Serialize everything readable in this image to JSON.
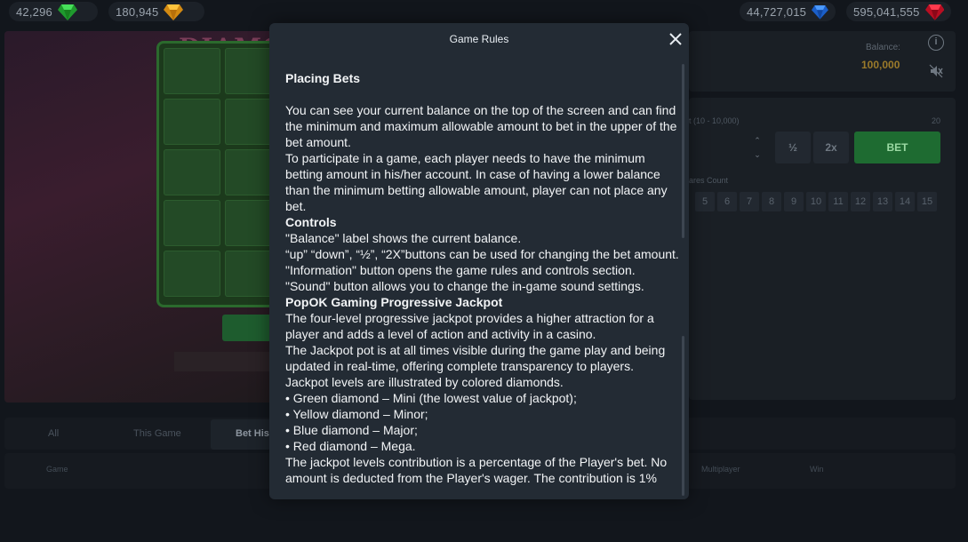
{
  "jackpots": [
    {
      "name": "green",
      "value": "42,296",
      "color": "#2ecc40"
    },
    {
      "name": "yellow",
      "value": "180,945",
      "color": "#f0a21a"
    },
    {
      "name": "blue",
      "value": "44,727,015",
      "color": "#1e6fe0"
    },
    {
      "name": "red",
      "value": "595,041,555",
      "color": "#d6102a"
    }
  ],
  "game": {
    "title": "DIAMO"
  },
  "account": {
    "balance_label": "Balance:",
    "balance_value": "100,000"
  },
  "bet": {
    "range_label": "t (10 - 10,000)",
    "max_label": "20",
    "half_label": "½",
    "double_label": "2x",
    "bet_label": "BET",
    "squares_label": "ares Count",
    "squares": [
      "5",
      "6",
      "7",
      "8",
      "9",
      "10",
      "11",
      "12",
      "13",
      "14",
      "15"
    ]
  },
  "tabs": [
    {
      "label": "All"
    },
    {
      "label": "This Game"
    },
    {
      "label": "Bet Hist"
    }
  ],
  "table_headers": [
    "Game",
    "Multiplayer",
    "Win"
  ],
  "modal": {
    "title": "Game Rules",
    "heading": "Placing Bets",
    "p1": "You can see your current balance on the top of the screen and can find the minimum and maximum allowable amount to bet in the upper of the bet amount.",
    "p2": "To participate in a game, each player needs to have the minimum betting amount in his/her account. In case of having a lower balance than the minimum betting allowable amount, player can not place any bet.",
    "controls_heading": "Controls",
    "c1": "\"Balance\" label shows the current balance.",
    "c2": "“up” “down”, “½”, “2X”buttons can be used for changing the bet amount.",
    "c3": "\"Information\" button opens the game rules and controls section.",
    "c4": "\"Sound\" button allows you to change the in-game sound settings.",
    "jackpot_heading": "PopOK Gaming Progressive Jackpot",
    "j1": "The four-level progressive jackpot provides a higher attraction for a player and adds a level of action and activity in a casino.",
    "j2": "The Jackpot pot is at all times visible during the game play and being updated in real-time, offering complete transparency to players.",
    "j3": "Jackpot levels are illustrated by colored diamonds.",
    "l1": "• Green diamond – Mini (the lowest value of jackpot);",
    "l2": "• Yellow diamond – Minor;",
    "l3": "• Blue diamond – Major;",
    "l4": "• Red diamond – Mega.",
    "j4": "The jackpot levels contribution is a percentage of the Player's bet. No amount is deducted from the Player's wager. The contribution is 1%"
  }
}
